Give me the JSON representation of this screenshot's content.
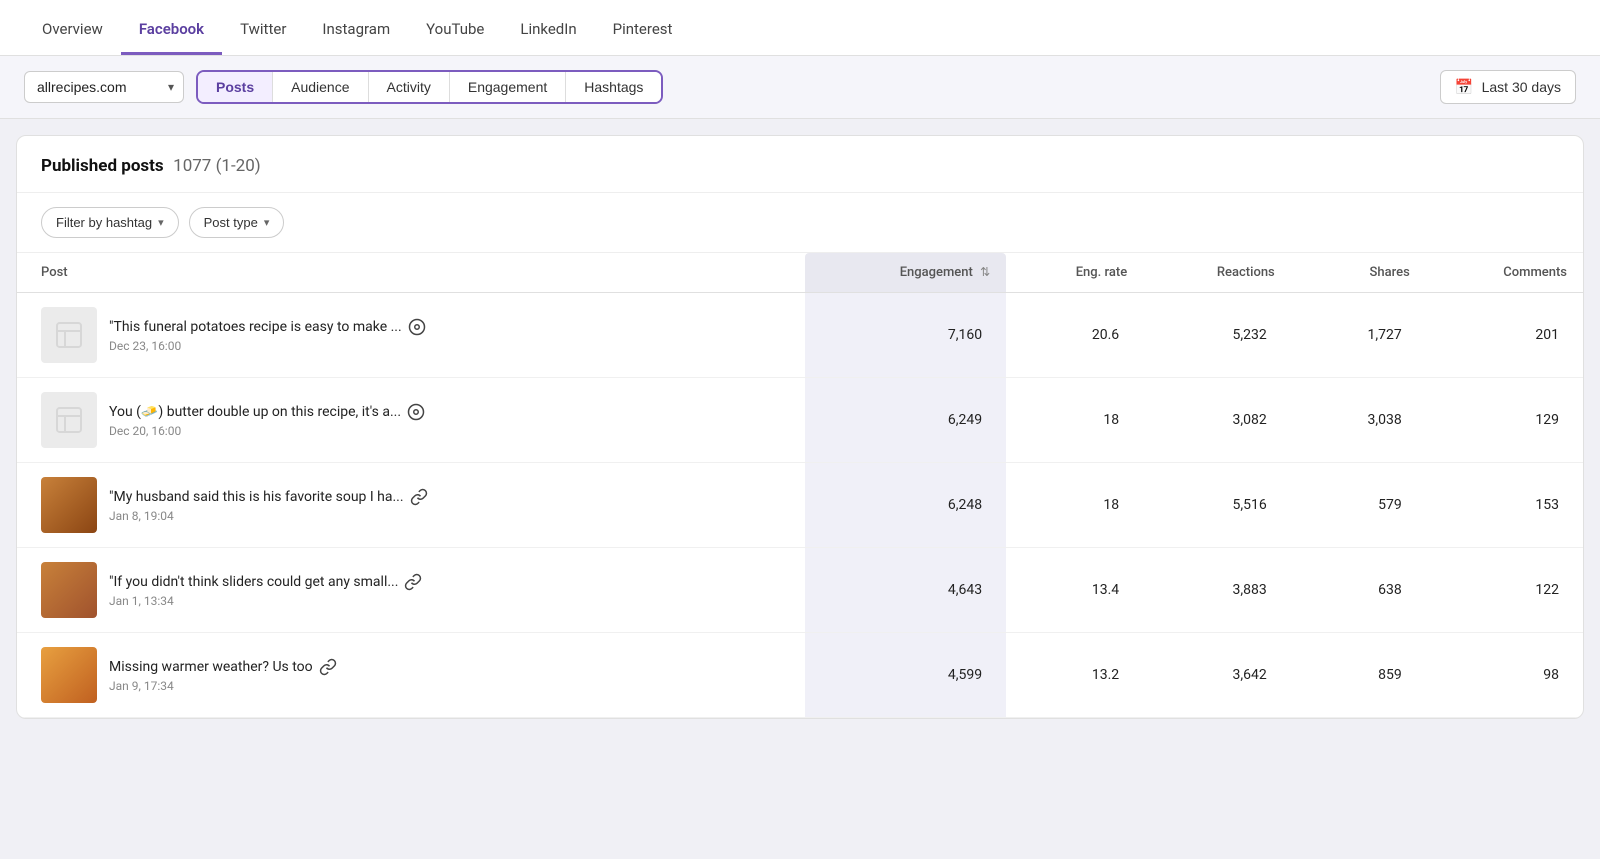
{
  "nav": {
    "items": [
      {
        "label": "Overview",
        "active": false
      },
      {
        "label": "Facebook",
        "active": true
      },
      {
        "label": "Twitter",
        "active": false
      },
      {
        "label": "Instagram",
        "active": false
      },
      {
        "label": "YouTube",
        "active": false
      },
      {
        "label": "LinkedIn",
        "active": false
      },
      {
        "label": "Pinterest",
        "active": false
      }
    ]
  },
  "toolbar": {
    "account": "allrecipes.com",
    "tabs": [
      {
        "label": "Posts",
        "active": true
      },
      {
        "label": "Audience",
        "active": false
      },
      {
        "label": "Activity",
        "active": false
      },
      {
        "label": "Engagement",
        "active": false
      },
      {
        "label": "Hashtags",
        "active": false
      }
    ],
    "date_range": "Last 30 days"
  },
  "published_posts": {
    "title": "Published posts",
    "count": "1077 (1-20)"
  },
  "filters": {
    "hashtag_label": "Filter by hashtag",
    "post_type_label": "Post type"
  },
  "table": {
    "columns": [
      "Post",
      "Engagement",
      "Eng. rate",
      "Reactions",
      "Shares",
      "Comments"
    ],
    "rows": [
      {
        "text": "\"This funeral potatoes recipe is easy to make ...",
        "date": "Dec 23, 16:00",
        "icon_type": "video",
        "engagement": "7,160",
        "eng_rate": "20.6",
        "reactions": "5,232",
        "shares": "1,727",
        "comments": "201",
        "thumb_type": "empty"
      },
      {
        "text": "You (🧈) butter double up on this recipe, it's a...",
        "date": "Dec 20, 16:00",
        "icon_type": "video",
        "engagement": "6,249",
        "eng_rate": "18",
        "reactions": "3,082",
        "shares": "3,038",
        "comments": "129",
        "thumb_type": "empty"
      },
      {
        "text": "\"My husband said this is his favorite soup I ha...",
        "date": "Jan 8, 19:04",
        "icon_type": "link",
        "engagement": "6,248",
        "eng_rate": "18",
        "reactions": "5,516",
        "shares": "579",
        "comments": "153",
        "thumb_type": "soup"
      },
      {
        "text": "\"If you didn't think sliders could get any small...",
        "date": "Jan 1, 13:34",
        "icon_type": "link",
        "engagement": "4,643",
        "eng_rate": "13.4",
        "reactions": "3,883",
        "shares": "638",
        "comments": "122",
        "thumb_type": "sliders"
      },
      {
        "text": "Missing warmer weather? Us too",
        "date": "Jan 9, 17:34",
        "icon_type": "link",
        "engagement": "4,599",
        "eng_rate": "13.2",
        "reactions": "3,642",
        "shares": "859",
        "comments": "98",
        "thumb_type": "weather"
      }
    ]
  }
}
